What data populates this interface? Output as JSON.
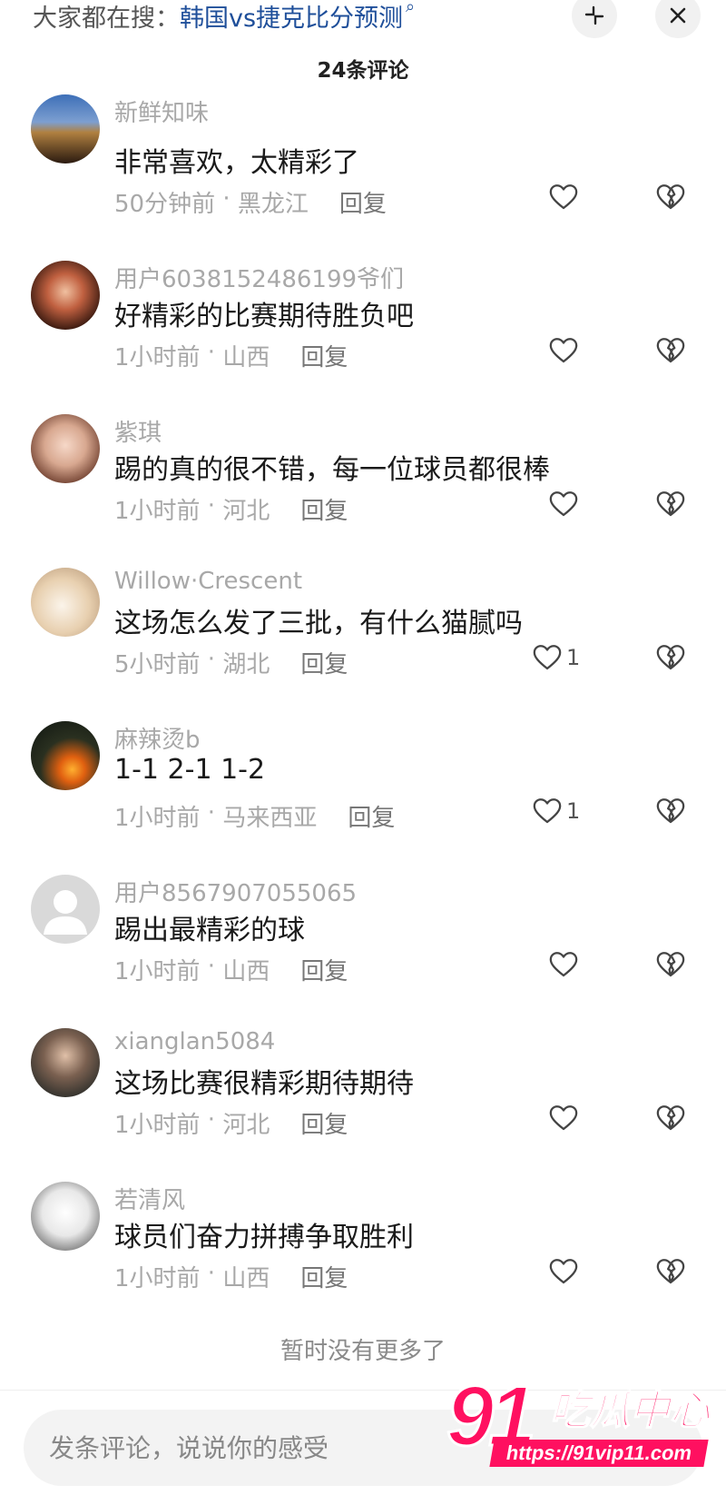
{
  "header": {
    "search_prefix": "大家都在搜：",
    "search_keyword": "韩国vs捷克比分预测",
    "search_icon": "magnifier-icon",
    "collapse_icon": "collapse-icon",
    "close_icon": "close-icon",
    "comment_count": "24条评论"
  },
  "comments": [
    {
      "name": "新鲜知味",
      "text": "非常喜欢，太精彩了",
      "time": "50分钟前",
      "region": "黑龙江",
      "reply": "回复",
      "likes": ""
    },
    {
      "name": "用户6038152486199爷们",
      "text": "好精彩的比赛期待胜负吧",
      "time": "1小时前",
      "region": "山西",
      "reply": "回复",
      "likes": ""
    },
    {
      "name": "紫琪",
      "text": "踢的真的很不错，每一位球员都很棒",
      "time": "1小时前",
      "region": "河北",
      "reply": "回复",
      "likes": ""
    },
    {
      "name": "Willow·Crescent",
      "text": "这场怎么发了三批，有什么猫腻吗",
      "time": "5小时前",
      "region": "湖北",
      "reply": "回复",
      "likes": "1"
    },
    {
      "name": "麻辣烫b",
      "text": "1-1 2-1 1-2",
      "time": "1小时前",
      "region": "马来西亚",
      "reply": "回复",
      "likes": "1"
    },
    {
      "name": "用户8567907055065",
      "text": "踢出最精彩的球",
      "time": "1小时前",
      "region": "山西",
      "reply": "回复",
      "likes": ""
    },
    {
      "name": "xianglan5084",
      "text": "这场比赛很精彩期待期待",
      "time": "1小时前",
      "region": "河北",
      "reply": "回复",
      "likes": ""
    },
    {
      "name": "若清风",
      "text": "球员们奋力拼搏争取胜利",
      "time": "1小时前",
      "region": "山西",
      "reply": "回复",
      "likes": ""
    }
  ],
  "footer": {
    "no_more": "暂时没有更多了",
    "input_placeholder": "发条评论，说说你的感受"
  },
  "watermark": {
    "number": "91",
    "name": "吃瓜中心",
    "url": "https://91vip11.com"
  },
  "colors": {
    "keyword": "#1f4f9a",
    "watermark": "#ff1060"
  }
}
